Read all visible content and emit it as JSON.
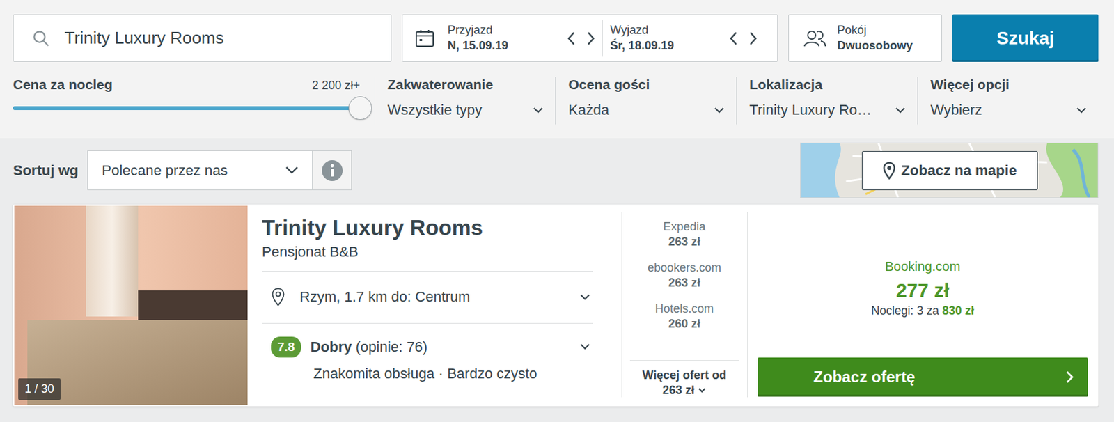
{
  "search": {
    "value": "Trinity Luxury Rooms"
  },
  "dates": [
    {
      "label": "Przyjazd",
      "value": "N, 15.09.19"
    },
    {
      "label": "Wyjazd",
      "value": "Śr, 18.09.19"
    }
  ],
  "room": {
    "label": "Pokój",
    "value": "Dwuosobowy"
  },
  "search_button": "Szukaj",
  "price_filter": {
    "label": "Cena za nocleg",
    "max": "2 200 zł+",
    "level": 1
  },
  "filters": [
    {
      "label": "Zakwaterowanie",
      "value": "Wszystkie typy"
    },
    {
      "label": "Ocena gości",
      "value": "Każda"
    },
    {
      "label": "Lokalizacja",
      "value": "Trinity Luxury Ro…"
    },
    {
      "label": "Więcej opcji",
      "value": "Wybierz"
    }
  ],
  "sort": {
    "label": "Sortuj wg",
    "value": "Polecane przez nas"
  },
  "map_button": "Zobacz na mapie",
  "results": [
    {
      "name": "Trinity Luxury Rooms",
      "type": "Pensjonat B&B",
      "photo_counter": "1 / 30",
      "location": "Rzym, 1.7 km do: Centrum",
      "rating": {
        "score": "7.8",
        "label": "Dobry",
        "count": "(opinie: 76)"
      },
      "highlights": "Znakomita obsługa · Bardzo czysto",
      "offers": [
        {
          "site": "Expedia",
          "price": "263 zł"
        },
        {
          "site": "ebookers.com",
          "price": "263 zł"
        },
        {
          "site": "Hotels.com",
          "price": "260 zł"
        }
      ],
      "more_offers": {
        "label": "Więcej ofert od",
        "price": "263 zł"
      },
      "best_offer": {
        "site": "Booking.com",
        "price": "277 zł",
        "nights_label": "Noclegi: 3 za",
        "total": "830 zł"
      },
      "cta": "Zobacz ofertę"
    }
  ]
}
